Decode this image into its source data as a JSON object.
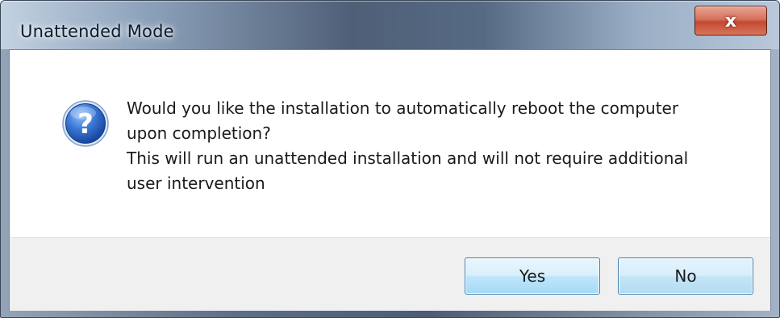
{
  "window": {
    "title": "Unattended Mode",
    "close_glyph": "x"
  },
  "dialog": {
    "icon": "question-icon",
    "message_lines": [
      "Would you like the installation to automatically reboot the computer",
      "upon completion?",
      "This will run an unattended installation and will not require additional",
      "user intervention"
    ],
    "icon_glyph": "?"
  },
  "buttons": {
    "yes_label": "Yes",
    "no_label": "No"
  },
  "colors": {
    "button_border": "#3c7fb1",
    "close_button": "#c24a30",
    "icon_blue": "#1f58b8"
  }
}
